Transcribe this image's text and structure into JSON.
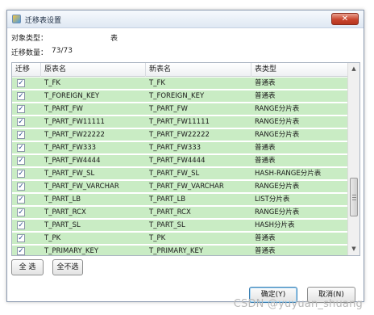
{
  "window": {
    "title": "迁移表设置",
    "close_glyph": "✕"
  },
  "info": {
    "object_type_label": "对象类型：",
    "object_type_value": "表",
    "migrate_count_label": "迁移数量：",
    "migrate_count_value": "73/73"
  },
  "grid": {
    "columns": [
      "迁移",
      "原表名",
      "新表名",
      "表类型"
    ],
    "row_color": "#c9ecc4",
    "rows": [
      {
        "checked": true,
        "source": "T_FK",
        "target": "T_FK",
        "type": "普通表"
      },
      {
        "checked": true,
        "source": "T_FOREIGN_KEY",
        "target": "T_FOREIGN_KEY",
        "type": "普通表"
      },
      {
        "checked": true,
        "source": "T_PART_FW",
        "target": "T_PART_FW",
        "type": "RANGE分片表"
      },
      {
        "checked": true,
        "source": "T_PART_FW11111",
        "target": "T_PART_FW11111",
        "type": "RANGE分片表"
      },
      {
        "checked": true,
        "source": "T_PART_FW22222",
        "target": "T_PART_FW22222",
        "type": "RANGE分片表"
      },
      {
        "checked": true,
        "source": "T_PART_FW333",
        "target": "T_PART_FW333",
        "type": "普通表"
      },
      {
        "checked": true,
        "source": "T_PART_FW4444",
        "target": "T_PART_FW4444",
        "type": "普通表"
      },
      {
        "checked": true,
        "source": "T_PART_FW_SL",
        "target": "T_PART_FW_SL",
        "type": "HASH-RANGE分片表"
      },
      {
        "checked": true,
        "source": "T_PART_FW_VARCHAR",
        "target": "T_PART_FW_VARCHAR",
        "type": "RANGE分片表"
      },
      {
        "checked": true,
        "source": "T_PART_LB",
        "target": "T_PART_LB",
        "type": "LIST分片表"
      },
      {
        "checked": true,
        "source": "T_PART_RCX",
        "target": "T_PART_RCX",
        "type": "RANGE分片表"
      },
      {
        "checked": true,
        "source": "T_PART_SL",
        "target": "T_PART_SL",
        "type": "HASH分片表"
      },
      {
        "checked": true,
        "source": "T_PK",
        "target": "T_PK",
        "type": "普通表"
      },
      {
        "checked": true,
        "source": "T_PRIMARY_KEY",
        "target": "T_PRIMARY_KEY",
        "type": "普通表"
      }
    ]
  },
  "buttons": {
    "select_all": "全 选",
    "deselect_all": "全不选",
    "ok": "确定(Y)",
    "cancel": "取消(N)"
  },
  "scroll": {
    "up_glyph": "▲",
    "down_glyph": "▼"
  },
  "watermark": "CSDN @yuyuan_shuang"
}
